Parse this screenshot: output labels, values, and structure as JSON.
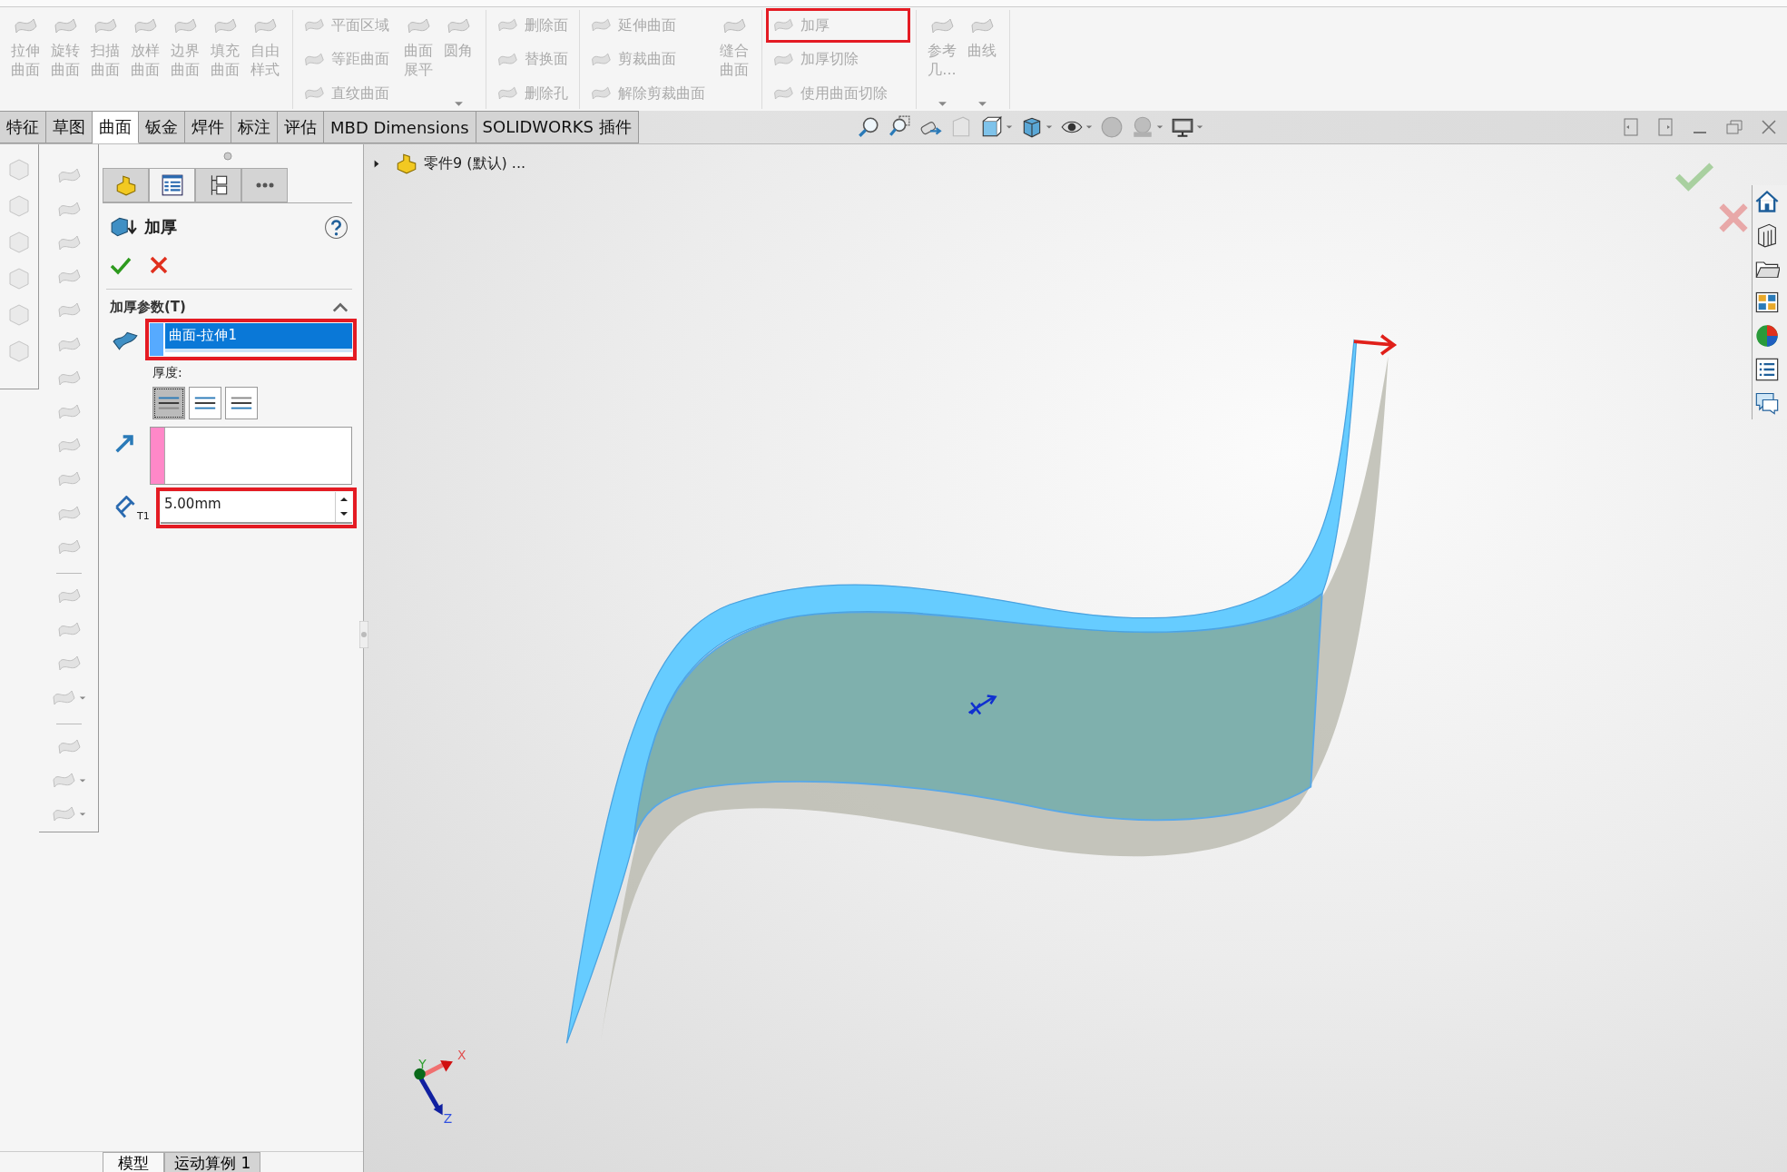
{
  "ribbon": {
    "sections": [
      {
        "columns": [
          {
            "kind": "large",
            "items": [
              {
                "label": "拉伸曲面",
                "disabled": true
              },
              {
                "label": "旋转曲面",
                "disabled": true
              },
              {
                "label": "扫描曲面",
                "disabled": true
              },
              {
                "label": "放样曲面",
                "disabled": true
              },
              {
                "label": "边界曲面",
                "disabled": true
              },
              {
                "label": "填充曲面",
                "disabled": true
              },
              {
                "label": "自由样式",
                "disabled": true
              }
            ]
          }
        ]
      },
      {
        "columns": [
          {
            "kind": "small",
            "items": [
              {
                "label": "平面区域",
                "disabled": true
              },
              {
                "label": "等距曲面",
                "disabled": true
              },
              {
                "label": "直纹曲面",
                "disabled": true
              }
            ]
          },
          {
            "kind": "large",
            "items": [
              {
                "label": "曲面展平",
                "disabled": true
              },
              {
                "label": "圆角",
                "disabled": true,
                "dropdown": true
              }
            ]
          }
        ]
      },
      {
        "columns": [
          {
            "kind": "small",
            "items": [
              {
                "label": "删除面",
                "disabled": true
              },
              {
                "label": "替换面",
                "disabled": true
              },
              {
                "label": "删除孔",
                "disabled": true
              }
            ]
          }
        ]
      },
      {
        "columns": [
          {
            "kind": "small",
            "items": [
              {
                "label": "延伸曲面",
                "disabled": true
              },
              {
                "label": "剪裁曲面",
                "disabled": true
              },
              {
                "label": "解除剪裁曲面",
                "disabled": true
              }
            ]
          },
          {
            "kind": "large",
            "items": [
              {
                "label": "缝合曲面",
                "disabled": true
              }
            ]
          }
        ]
      },
      {
        "columns": [
          {
            "kind": "small",
            "items": [
              {
                "label": "加厚",
                "disabled": true,
                "highlighted": true
              },
              {
                "label": "加厚切除",
                "disabled": true,
                "highlighted": false
              },
              {
                "label": "使用曲面切除",
                "disabled": true,
                "highlighted": false
              }
            ]
          }
        ]
      },
      {
        "columns": [
          {
            "kind": "large",
            "items": [
              {
                "label": "参考几...",
                "disabled": true,
                "dropdown": true
              },
              {
                "label": "曲线",
                "disabled": true,
                "dropdown": true
              }
            ]
          }
        ]
      }
    ]
  },
  "tabs": [
    {
      "label": "特征",
      "selected": false
    },
    {
      "label": "草图",
      "selected": false
    },
    {
      "label": "曲面",
      "selected": true
    },
    {
      "label": "钣金",
      "selected": false
    },
    {
      "label": "焊件",
      "selected": false
    },
    {
      "label": "标注",
      "selected": false
    },
    {
      "label": "评估",
      "selected": false
    },
    {
      "label": "MBD Dimensions",
      "selected": false
    },
    {
      "label": "SOLIDWORKS 插件",
      "selected": false
    }
  ],
  "property_manager": {
    "tabs": [
      {
        "selected": false
      },
      {
        "selected": true
      },
      {
        "selected": false
      },
      {
        "selected": false
      }
    ],
    "title": "加厚",
    "section": {
      "title": "加厚参数(T)",
      "expanded": true
    },
    "selection_list": {
      "highlighted": true,
      "items": [
        {
          "label": "曲面-拉伸1",
          "selected": true
        }
      ]
    },
    "thickness_label": "厚度:",
    "thickness_options": [
      {
        "selected": true
      },
      {
        "selected": false
      },
      {
        "selected": false
      }
    ],
    "thickness": {
      "icon_label": "T1",
      "value": "5.00mm",
      "highlighted": true
    }
  },
  "feature_tree": {
    "title": "零件9 (默认) ...",
    "expanded": false
  },
  "triad": {
    "labels": [
      "X",
      "Y",
      "Z"
    ]
  },
  "bottom_tabs": [
    {
      "label": "模型",
      "selected": true
    },
    {
      "label": "运动算例 1",
      "selected": false
    }
  ]
}
